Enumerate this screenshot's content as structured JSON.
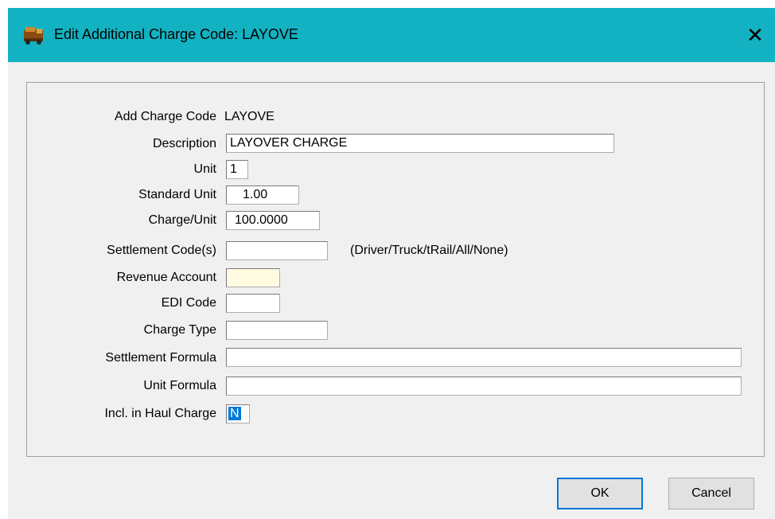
{
  "window": {
    "title": "Edit Additional Charge Code: LAYOVE",
    "close_glyph": "✕",
    "icon": "truck-app-icon"
  },
  "form": {
    "add_charge_code": {
      "label": "Add Charge Code",
      "value": "LAYOVE"
    },
    "description": {
      "label": "Description",
      "value": "LAYOVER CHARGE"
    },
    "unit": {
      "label": "Unit",
      "value": "1"
    },
    "standard_unit": {
      "label": "Standard Unit",
      "value": "1.00"
    },
    "charge_unit": {
      "label": "Charge/Unit",
      "value": "100.0000"
    },
    "settlement_codes": {
      "label": "Settlement Code(s)",
      "value": "",
      "hint": "(Driver/Truck/tRail/All/None)"
    },
    "revenue_account": {
      "label": "Revenue Account",
      "value": ""
    },
    "edi_code": {
      "label": "EDI Code",
      "value": ""
    },
    "charge_type": {
      "label": "Charge Type",
      "value": ""
    },
    "settlement_formula": {
      "label": "Settlement Formula",
      "value": ""
    },
    "unit_formula": {
      "label": "Unit Formula",
      "value": ""
    },
    "incl_haul_charge": {
      "label": "Incl. in Haul Charge",
      "value": "N"
    }
  },
  "buttons": {
    "ok_label": "OK",
    "cancel_label": "Cancel"
  },
  "colors": {
    "titlebar": "#12b2c2",
    "dialog_bg": "#f0f0f0",
    "selection": "#0078d7",
    "readonly_field": "#fffbe0"
  }
}
